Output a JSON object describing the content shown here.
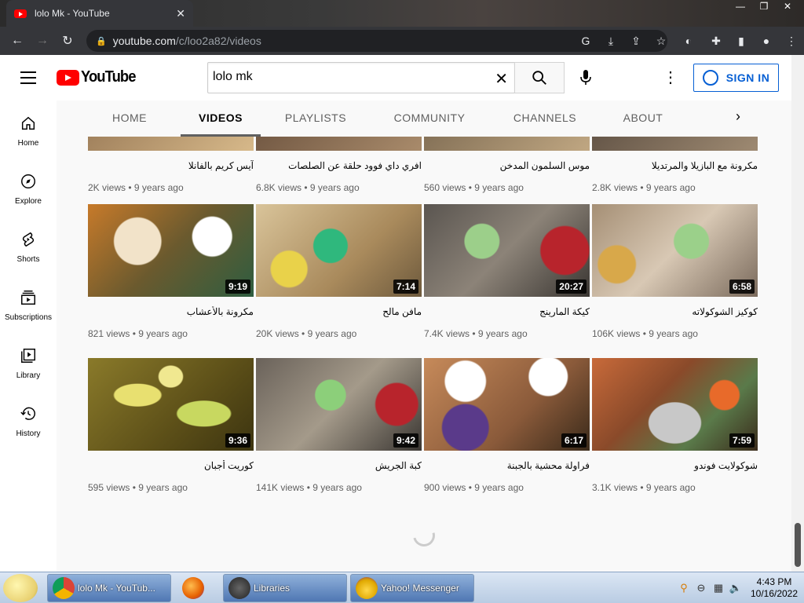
{
  "browser": {
    "tab_title": "lolo Mk - YouTube",
    "url_host": "youtube.com",
    "url_path": "/c/loo2a82/videos"
  },
  "header": {
    "logo_text": "YouTube",
    "search_value": "lolo mk",
    "signin_label": "SIGN IN"
  },
  "channel_tabs": [
    "HOME",
    "VIDEOS",
    "PLAYLISTS",
    "COMMUNITY",
    "CHANNELS",
    "ABOUT"
  ],
  "active_tab": "VIDEOS",
  "sidebar": [
    {
      "label": "Home",
      "icon": "home-icon"
    },
    {
      "label": "Explore",
      "icon": "compass-icon"
    },
    {
      "label": "Shorts",
      "icon": "shorts-icon"
    },
    {
      "label": "Subscriptions",
      "icon": "subscriptions-icon"
    },
    {
      "label": "Library",
      "icon": "library-icon"
    },
    {
      "label": "History",
      "icon": "history-icon"
    }
  ],
  "videos": [
    {
      "title": "آيس كريم بالفانلا",
      "views": "2K views",
      "age": "9 years ago",
      "duration": ""
    },
    {
      "title": "افري داي فوود حلقة عن الصلصات",
      "views": "6.8K views",
      "age": "9 years ago",
      "duration": ""
    },
    {
      "title": "موس السلمون المدخن",
      "views": "560 views",
      "age": "9 years ago",
      "duration": ""
    },
    {
      "title": "مكرونة مع البازيلا والمرتديلا",
      "views": "2.8K views",
      "age": "9 years ago",
      "duration": ""
    },
    {
      "title": "مكرونة بالأعشاب",
      "views": "821 views",
      "age": "9 years ago",
      "duration": "9:19"
    },
    {
      "title": "مافن مالح",
      "views": "20K views",
      "age": "9 years ago",
      "duration": "7:14"
    },
    {
      "title": "كيكة المارينج",
      "views": "7.4K views",
      "age": "9 years ago",
      "duration": "20:27"
    },
    {
      "title": "كوكيز الشوكولاته",
      "views": "106K views",
      "age": "9 years ago",
      "duration": "6:58"
    },
    {
      "title": "كوريت أجبان",
      "views": "595 views",
      "age": "9 years ago",
      "duration": "9:36"
    },
    {
      "title": "كبة الجريش",
      "views": "141K views",
      "age": "9 years ago",
      "duration": "9:42"
    },
    {
      "title": "فراولة محشية بالجبنة",
      "views": "900 views",
      "age": "9 years ago",
      "duration": "6:17"
    },
    {
      "title": "شوكولايت فوندو",
      "views": "3.1K views",
      "age": "9 years ago",
      "duration": "7:59"
    }
  ],
  "taskbar": {
    "chrome_task": "lolo Mk - YouTub...",
    "libraries_task": "Libraries",
    "yahoo_task": "Yahoo! Messenger",
    "time": "4:43 PM",
    "date": "10/16/2022"
  },
  "colors": {
    "yt_red": "#ff0000",
    "signin_blue": "#065fd4"
  }
}
